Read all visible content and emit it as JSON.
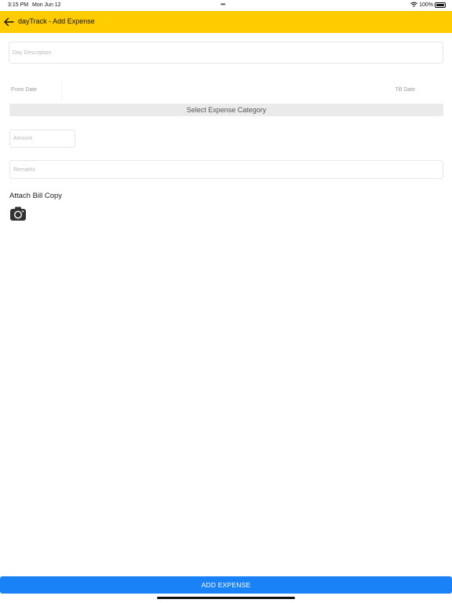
{
  "status_bar": {
    "time": "3:15 PM",
    "date": "Mon Jun 12",
    "dots": "•••",
    "battery": "100%"
  },
  "header": {
    "title": "dayTrack - Add Expense",
    "background_color": "#ffcc00"
  },
  "form": {
    "day_description_placeholder": "Day Description",
    "from_date_label": "From Date",
    "till_date_label": "Till Date",
    "category_button_label": "Select Expense Category",
    "amount_placeholder": "Amount",
    "remarks_placeholder": "Remarks",
    "attach_label": "Attach Bill Copy",
    "camera_icon": "camera-icon"
  },
  "footer": {
    "add_button_label": "ADD EXPENSE",
    "button_color": "#1a82f7"
  }
}
